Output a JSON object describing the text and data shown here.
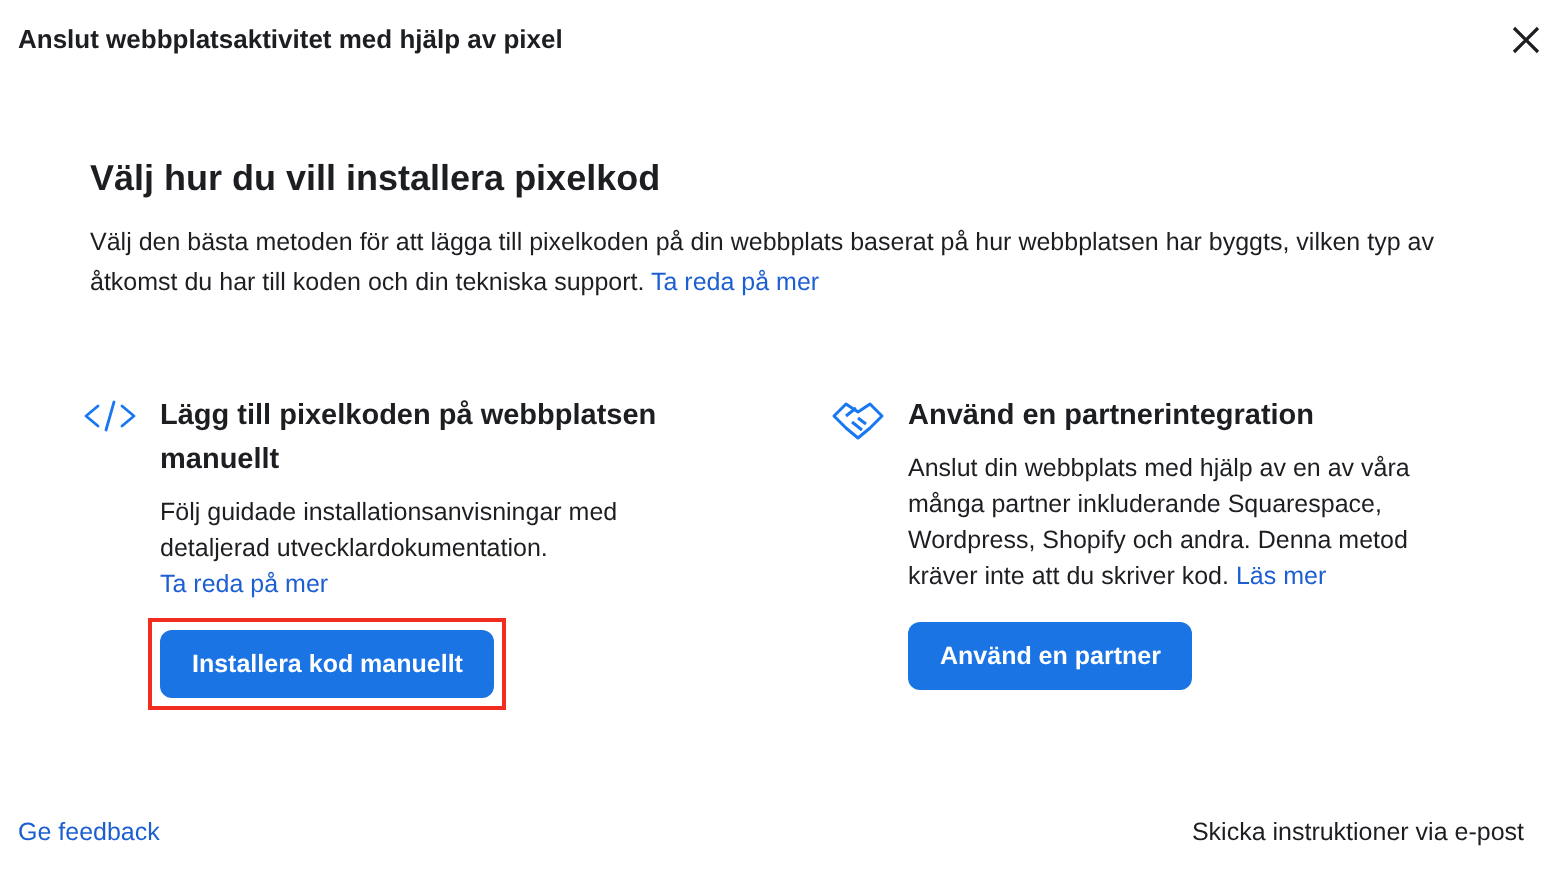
{
  "window": {
    "title": "Anslut webbplatsaktivitet med hjälp av pixel"
  },
  "heading": "Välj hur du vill installera pixelkod",
  "intro": {
    "text": "Välj den bästa metoden för att lägga till pixelkoden på din webbplats baserat på hur webbplatsen har byggts, vilken typ av åtkomst du har till koden och din tekniska support.",
    "link": "Ta reda på mer"
  },
  "options": [
    {
      "kind": "code",
      "title": "Lägg till pixelkoden på webbplatsen manuellt",
      "text": "Följ guidade installationsanvisningar med detaljerad utvecklardokumentation.",
      "link": "Ta reda på mer",
      "button": "Installera kod manuellt",
      "highlighted": true
    },
    {
      "kind": "partner",
      "title": "Använd en partnerintegration",
      "text": "Anslut din webbplats med hjälp av en av våra många partner inkluderande Squarespace, Wordpress, Shopify och andra. Denna metod kräver inte att du skriver kod.",
      "link": "Läs mer",
      "button": "Använd en partner",
      "highlighted": false
    }
  ],
  "footer": {
    "left_link": "Ge feedback",
    "right_link": "Skicka instruktioner via e-post"
  }
}
